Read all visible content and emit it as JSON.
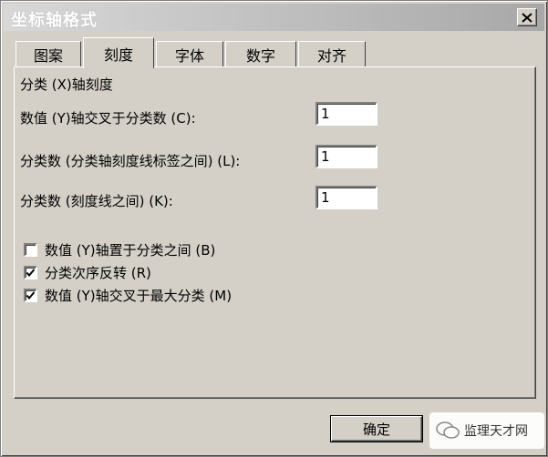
{
  "window": {
    "title": "坐标轴格式"
  },
  "tabs": [
    {
      "label": "图案"
    },
    {
      "label": "刻度",
      "active": true
    },
    {
      "label": "字体"
    },
    {
      "label": "数字"
    },
    {
      "label": "对齐"
    }
  ],
  "panel": {
    "group_label": "分类 (X)轴刻度",
    "fields": [
      {
        "label": "数值 (Y)轴交叉于分类数 (C):",
        "value": "1"
      },
      {
        "label": "分类数 (分类轴刻度线标签之间) (L):",
        "value": "1"
      },
      {
        "label": "分类数 (刻度线之间) (K):",
        "value": "1"
      }
    ],
    "checkboxes": [
      {
        "label": "数值 (Y)轴置于分类之间 (B)",
        "checked": false
      },
      {
        "label": "分类次序反转 (R)",
        "checked": true
      },
      {
        "label": "数值 (Y)轴交叉于最大分类 (M)",
        "checked": true
      }
    ]
  },
  "buttons": {
    "ok_label": "确定"
  },
  "watermark": {
    "text": "监理天才网"
  },
  "colors": {
    "face": "#d4d0c8",
    "titlebar": "#b0b0b0"
  }
}
